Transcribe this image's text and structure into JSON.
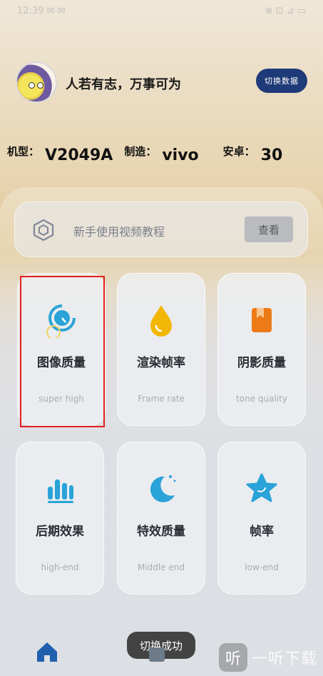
{
  "statusbar": {
    "left": "12:39 ✉ ✉",
    "right": "⊗ ⊡ ⊿ ▭"
  },
  "profile": {
    "motto": "人若有志，万事可为",
    "switch_label": "切换数据"
  },
  "device": {
    "model_label": "机型：",
    "model_value": "V2049A",
    "maker_label": "制造：",
    "maker_value": "vivo",
    "android_label": "安卓：",
    "android_value": "30"
  },
  "tutorial": {
    "title": "新手使用视频教程",
    "button": "查看",
    "icon": "hexagon-icon"
  },
  "cards": [
    {
      "label": "图像质量",
      "sub": "super high",
      "icon": "gauge-icon",
      "color": "#2aa3d8"
    },
    {
      "label": "渲染帧率",
      "sub": "Frame rate",
      "icon": "drop-icon",
      "color": "#f2b705"
    },
    {
      "label": "阴影质量",
      "sub": "tone quality",
      "icon": "bookmark-icon",
      "color": "#ec7a16"
    },
    {
      "label": "后期效果",
      "sub": "high-end",
      "icon": "bars-icon",
      "color": "#2aa3d8"
    },
    {
      "label": "特效质量",
      "sub": "Middle end",
      "icon": "moon-icon",
      "color": "#2aa3d8"
    },
    {
      "label": "帧率",
      "sub": "low-end",
      "icon": "star-icon",
      "color": "#2aa3d8"
    }
  ],
  "toast": "切换成功",
  "watermark": {
    "badge": "听",
    "text": "一听下载"
  },
  "colors": {
    "accent": "#1f3a78",
    "selected": "#e51e1e"
  }
}
